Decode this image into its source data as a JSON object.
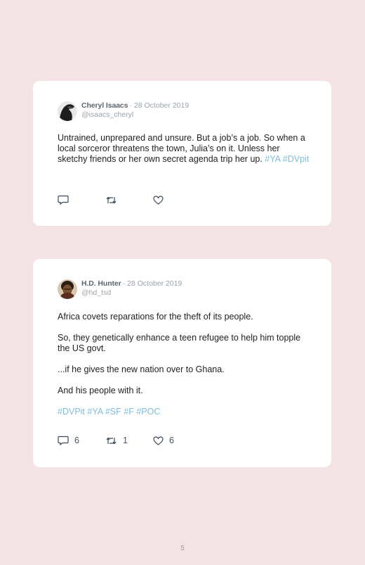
{
  "tweets": [
    {
      "name": "Cheryl Isaacs",
      "separator": "·",
      "date": "28 October 2019",
      "handle": "@isaacs_cheryl",
      "paragraphs": [
        {
          "text": "Untrained, unprepared and unsure. But a job’s a job. So when a local sorceror threatens the town, Julia’s on it. Unless her sketchy friends or her own secret agenda trip her up. ",
          "tags": "#YA #DVpit"
        }
      ],
      "reply_count": "",
      "retweet_count": "",
      "like_count": ""
    },
    {
      "name": "H.D. Hunter",
      "separator": "·",
      "date": "28 October 2019",
      "handle": "@hd_tsd",
      "paragraphs": [
        {
          "text": "Africa covets reparations for the theft of its people."
        },
        {
          "text": "So, they genetically enhance a teen refugee to help him topple the US govt."
        },
        {
          "text": "...if he gives the new nation over to Ghana."
        },
        {
          "text": "And his people with it."
        },
        {
          "tags": "#DVPit #YA #SF #F #POC"
        }
      ],
      "reply_count": "6",
      "retweet_count": "1",
      "like_count": "6"
    }
  ],
  "page_number": "5",
  "colors": {
    "background": "#f4e3e4",
    "card": "#ffffff",
    "hashtag": "#7fbcd9"
  },
  "icons": [
    "reply-icon",
    "retweet-icon",
    "like-icon"
  ]
}
